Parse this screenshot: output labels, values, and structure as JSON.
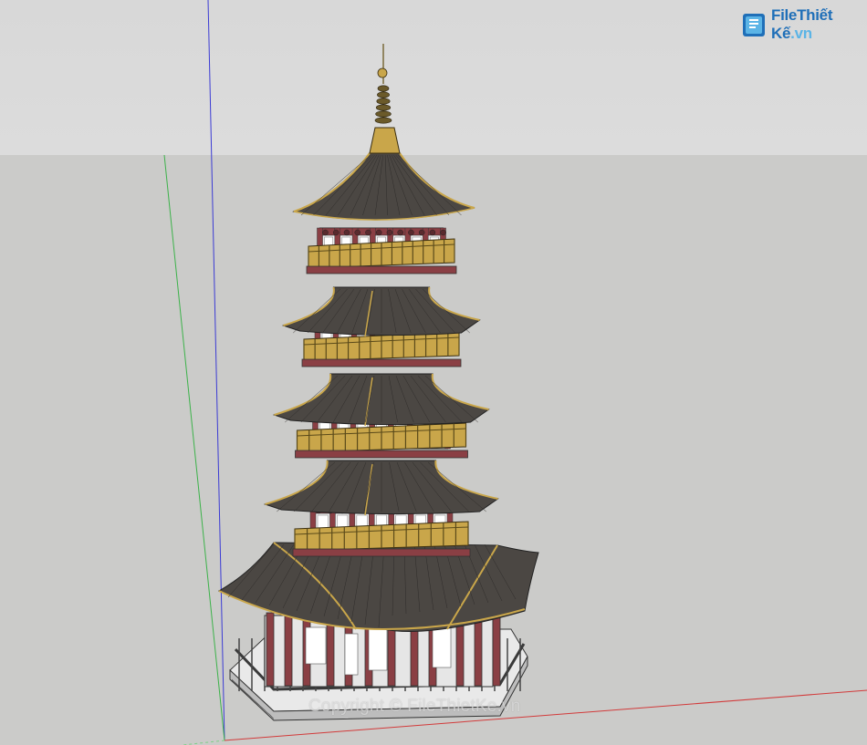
{
  "viewport": {
    "sky_color": "#dcdcdc",
    "ground_color": "#cbcbc9",
    "axis_colors": {
      "blue": "#3b3bd4",
      "green": "#3cb24a",
      "red": "#d23a3a"
    }
  },
  "model": {
    "name_icon": "pagoda-model",
    "roof_color": "#4b4743",
    "wall_color": "#8a3f44",
    "gold_color": "#c9a64a",
    "window_color": "#ffffff"
  },
  "logo": {
    "part1": "File",
    "part2": "Thiết Kế",
    "part3": ".vn",
    "icon": "file-logo-icon"
  },
  "watermark": {
    "text": "Copyright © FileThietKe.vn"
  }
}
